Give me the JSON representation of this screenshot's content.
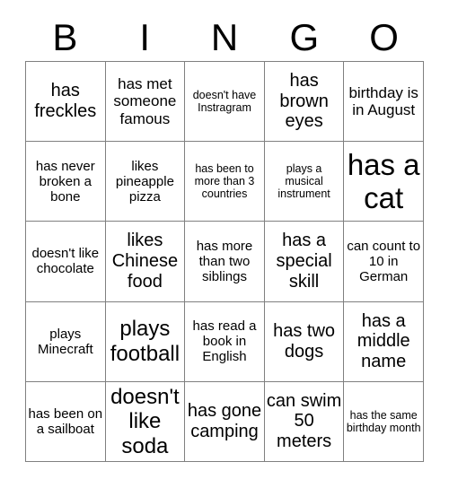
{
  "header": {
    "letters": [
      "B",
      "I",
      "N",
      "G",
      "O"
    ]
  },
  "grid": {
    "rows": [
      [
        {
          "text": "has freckles",
          "size": "fs-l"
        },
        {
          "text": "has met someone famous",
          "size": "fs-m"
        },
        {
          "text": "doesn't have Instragram",
          "size": "fs-xs"
        },
        {
          "text": "has brown eyes",
          "size": "fs-l"
        },
        {
          "text": "birthday is in August",
          "size": "fs-m"
        }
      ],
      [
        {
          "text": "has never broken a bone",
          "size": "fs-s"
        },
        {
          "text": "likes pineapple pizza",
          "size": "fs-s"
        },
        {
          "text": "has been to more than 3 countries",
          "size": "fs-xs"
        },
        {
          "text": "plays a musical instrument",
          "size": "fs-xs"
        },
        {
          "text": "has a cat",
          "size": "fs-xxl"
        }
      ],
      [
        {
          "text": "doesn't like chocolate",
          "size": "fs-s"
        },
        {
          "text": "likes Chinese food",
          "size": "fs-l"
        },
        {
          "text": "has more than two siblings",
          "size": "fs-s"
        },
        {
          "text": "has a special skill",
          "size": "fs-l"
        },
        {
          "text": "can count to 10 in German",
          "size": "fs-s"
        }
      ],
      [
        {
          "text": "plays Minecraft",
          "size": "fs-s"
        },
        {
          "text": "plays football",
          "size": "fs-xl"
        },
        {
          "text": "has read a book in English",
          "size": "fs-s"
        },
        {
          "text": "has two dogs",
          "size": "fs-l"
        },
        {
          "text": "has a middle name",
          "size": "fs-l"
        }
      ],
      [
        {
          "text": "has been on a sailboat",
          "size": "fs-s"
        },
        {
          "text": "doesn't like soda",
          "size": "fs-xl"
        },
        {
          "text": "has gone camping",
          "size": "fs-l"
        },
        {
          "text": "can swim 50 meters",
          "size": "fs-l"
        },
        {
          "text": "has the same birthday month",
          "size": "fs-xs"
        }
      ]
    ]
  }
}
